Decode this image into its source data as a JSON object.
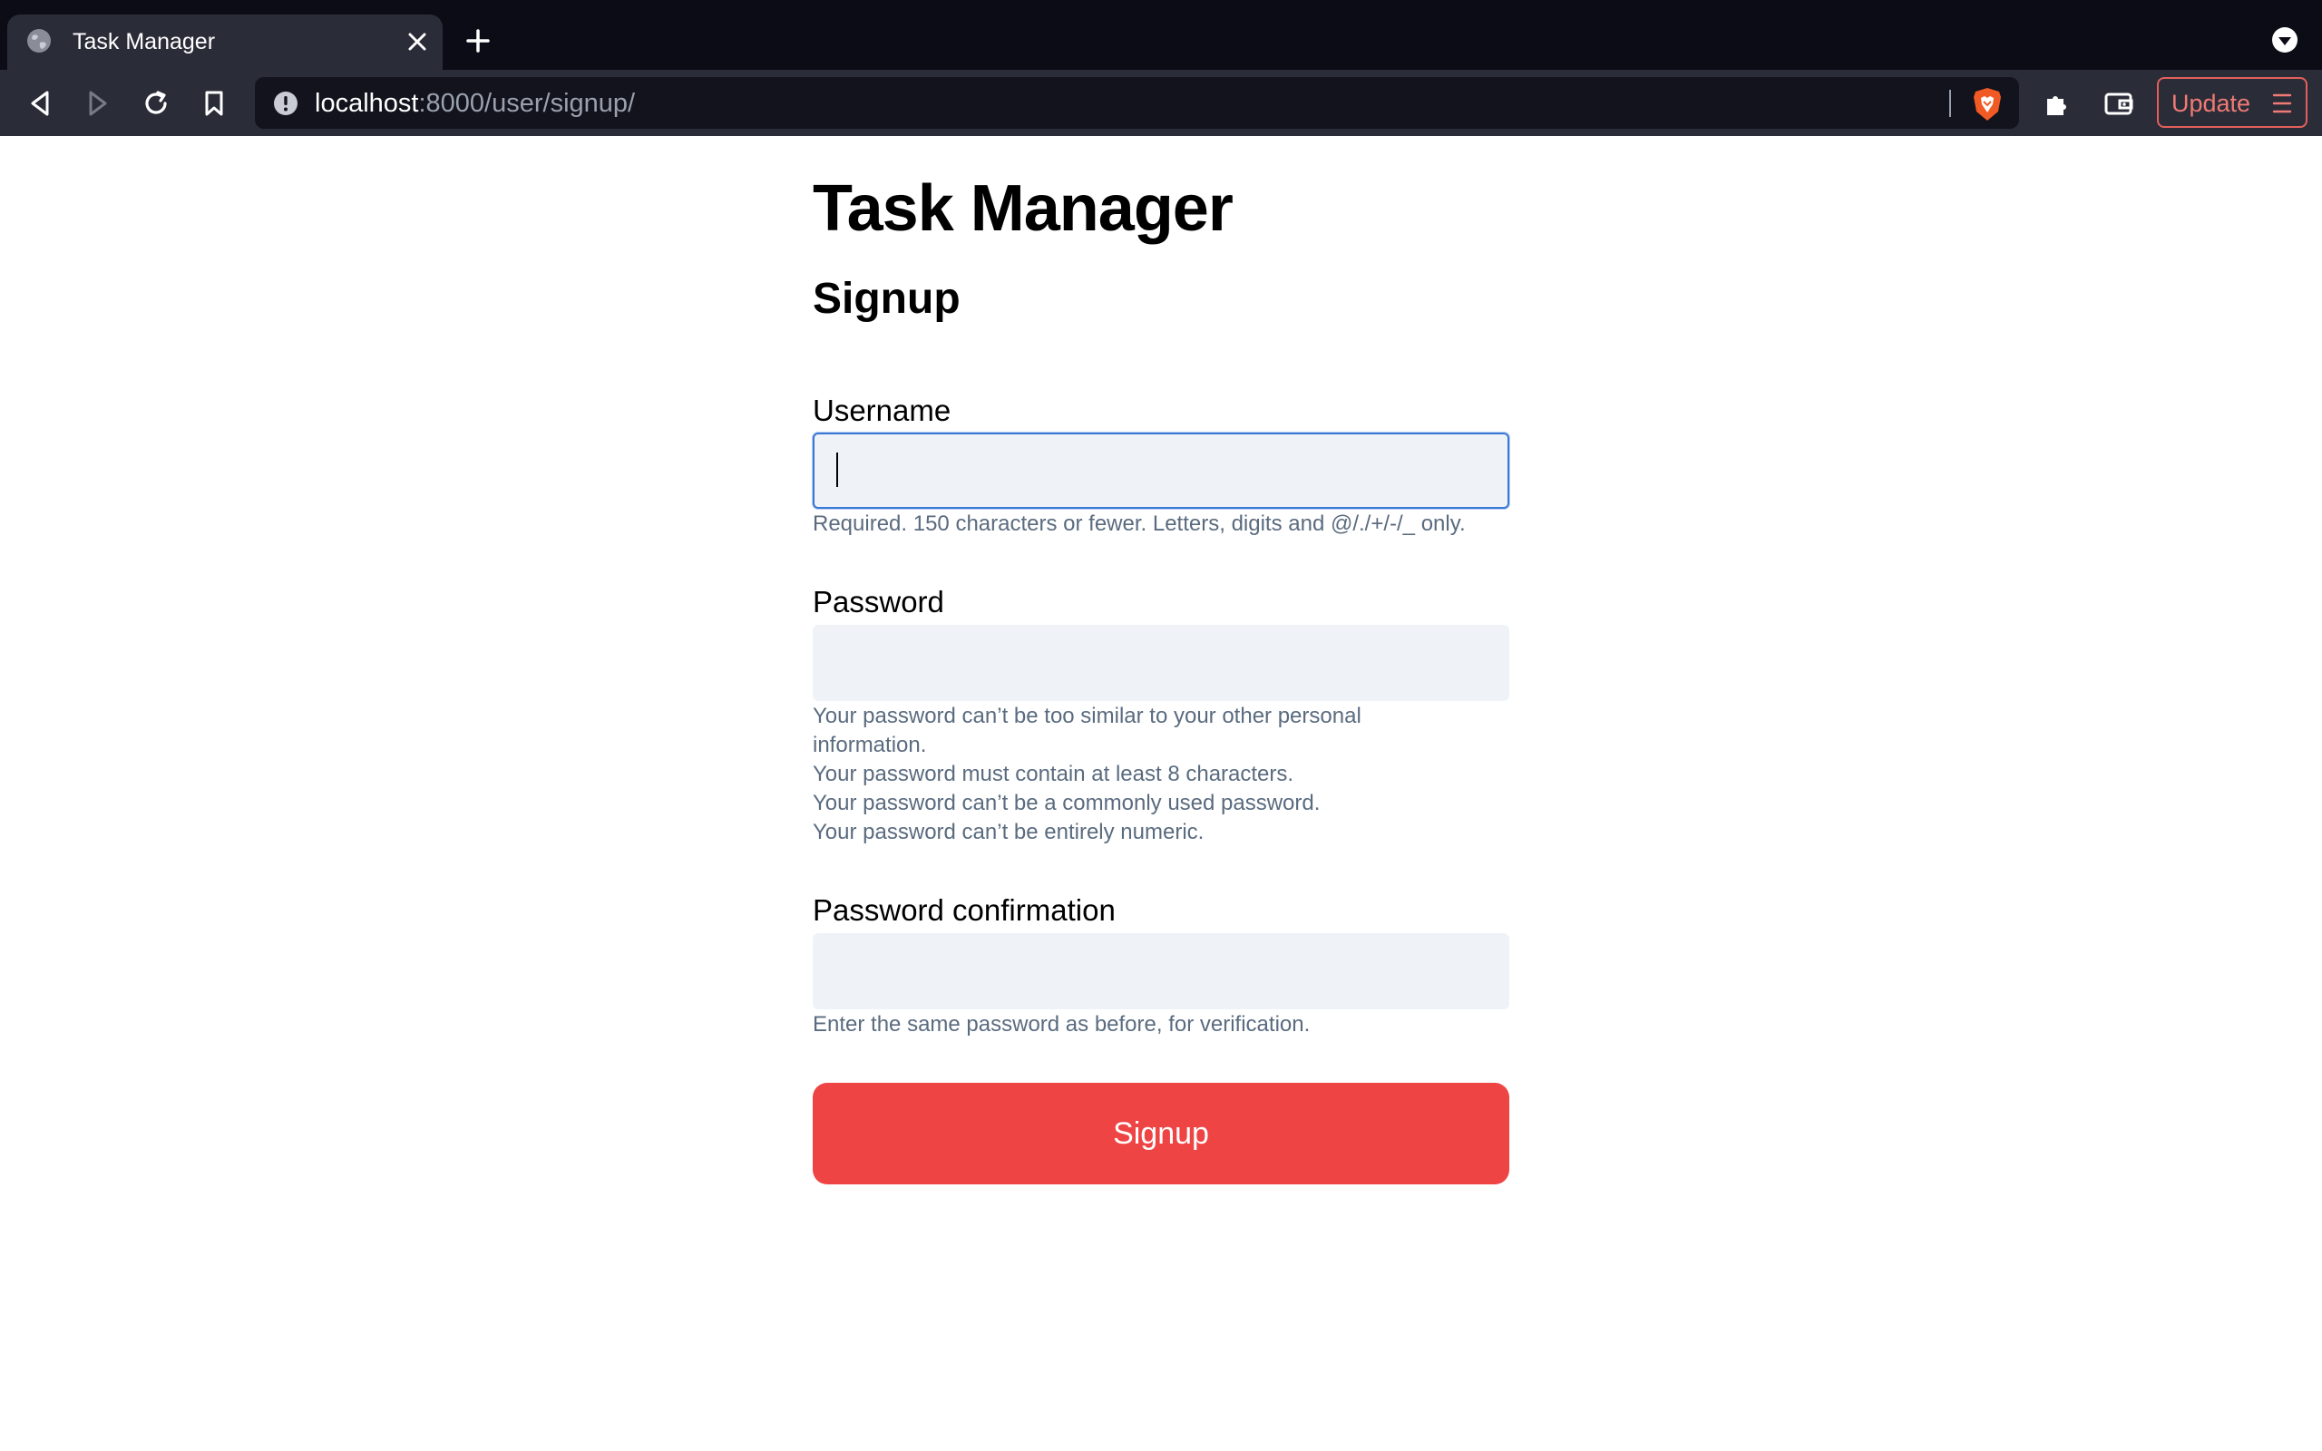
{
  "browser": {
    "tab": {
      "title": "Task Manager",
      "favicon": "globe-icon"
    },
    "address": {
      "host": "localhost",
      "path": ":8000/user/signup/"
    },
    "update_label": "Update",
    "colors": {
      "chrome_dark": "#0b0c16",
      "toolbar": "#2a2c38",
      "brave_orange": "#f15a24",
      "update_red": "#e2605a"
    }
  },
  "page": {
    "app_title": "Task Manager",
    "heading": "Signup",
    "fields": [
      {
        "label": "Username",
        "value": "",
        "focused": true,
        "help": [
          "Required. 150 characters or fewer. Letters, digits and @/./+/-/_ only."
        ]
      },
      {
        "label": "Password",
        "value": "",
        "focused": false,
        "help": [
          "Your password can’t be too similar to your other personal information.",
          "Your password must contain at least 8 characters.",
          "Your password can’t be a commonly used password.",
          "Your password can’t be entirely numeric."
        ]
      },
      {
        "label": "Password confirmation",
        "value": "",
        "focused": false,
        "help": [
          "Enter the same password as before, for verification."
        ]
      }
    ],
    "submit_label": "Signup",
    "colors": {
      "accent": "#ef4444",
      "input_bg": "#eff3f8",
      "focus_ring": "#3b78d6",
      "help_text": "#5a6b7f"
    }
  }
}
